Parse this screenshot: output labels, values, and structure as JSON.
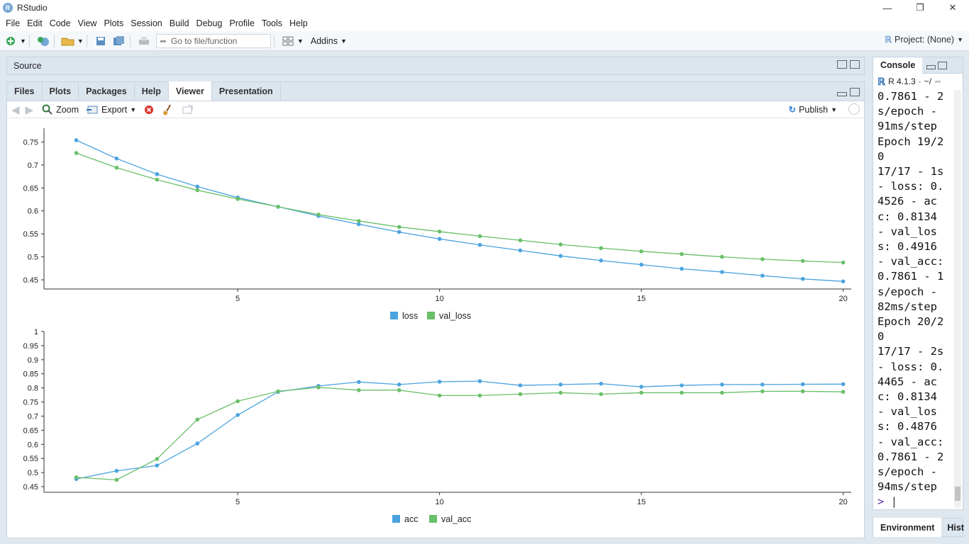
{
  "app": {
    "title": "RStudio",
    "logo_letter": "R"
  },
  "window_controls": {
    "minimize": "—",
    "maximize": "❐",
    "close": "✕"
  },
  "menu": [
    "File",
    "Edit",
    "Code",
    "View",
    "Plots",
    "Session",
    "Build",
    "Debug",
    "Profile",
    "Tools",
    "Help"
  ],
  "toolbar": {
    "goto_placeholder": "Go to file/function",
    "addins": "Addins",
    "project": "Project: (None)"
  },
  "source_pane": {
    "label": "Source"
  },
  "viewer_pane": {
    "tabs": [
      "Files",
      "Plots",
      "Packages",
      "Help",
      "Viewer",
      "Presentation"
    ],
    "active_tab": "Viewer",
    "zoom": "Zoom",
    "export": "Export",
    "publish": "Publish"
  },
  "console": {
    "tab": "Console",
    "version": "R 4.1.3",
    "path": "~/",
    "lines": [
      "0.7861 - 2",
      "s/epoch -",
      "91ms/step",
      "Epoch 19/2",
      "0",
      "17/17 - 1s",
      "- loss: 0.",
      "4526 - ac",
      "c: 0.8134",
      "- val_los",
      "s: 0.4916",
      "- val_acc:",
      "0.7861 - 1",
      "s/epoch -",
      "82ms/step",
      "Epoch 20/2",
      "0",
      "17/17 - 2s",
      "- loss: 0.",
      "4465 - ac",
      "c: 0.8134",
      "- val_los",
      "s: 0.4876",
      "- val_acc:",
      "0.7861 - 2",
      "s/epoch -",
      "94ms/step"
    ],
    "prompt": ">"
  },
  "environment_pane": {
    "tab": "Environment",
    "tab2": "Hist"
  },
  "colors": {
    "loss": "#4aa3df",
    "val_loss": "#6abf69",
    "accent": "#75a7d6"
  },
  "chart_data": [
    {
      "type": "line",
      "x": [
        1,
        2,
        3,
        4,
        5,
        6,
        7,
        8,
        9,
        10,
        11,
        12,
        13,
        14,
        15,
        16,
        17,
        18,
        19,
        20
      ],
      "series": [
        {
          "name": "loss",
          "values": [
            0.754,
            0.714,
            0.68,
            0.653,
            0.629,
            0.609,
            0.589,
            0.571,
            0.554,
            0.539,
            0.526,
            0.514,
            0.502,
            0.492,
            0.483,
            0.474,
            0.467,
            0.459,
            0.452,
            0.4465
          ]
        },
        {
          "name": "val_loss",
          "values": [
            0.726,
            0.694,
            0.668,
            0.645,
            0.626,
            0.609,
            0.592,
            0.578,
            0.565,
            0.555,
            0.545,
            0.536,
            0.527,
            0.519,
            0.512,
            0.506,
            0.5,
            0.495,
            0.491,
            0.4876
          ]
        }
      ],
      "yticks": [
        "0.75",
        "0.7",
        "0.65",
        "0.6",
        "0.55",
        "0.5",
        "0.45"
      ],
      "xticks": [
        "5",
        "10",
        "15",
        "20"
      ],
      "ylim": [
        0.43,
        0.78
      ],
      "xlim": [
        0.2,
        20.2
      ],
      "legend": "bottom"
    },
    {
      "type": "line",
      "x": [
        1,
        2,
        3,
        4,
        5,
        6,
        7,
        8,
        9,
        10,
        11,
        12,
        13,
        14,
        15,
        16,
        17,
        18,
        19,
        20
      ],
      "series": [
        {
          "name": "acc",
          "values": [
            0.477,
            0.506,
            0.525,
            0.603,
            0.704,
            0.786,
            0.807,
            0.821,
            0.812,
            0.822,
            0.824,
            0.809,
            0.812,
            0.815,
            0.804,
            0.809,
            0.812,
            0.812,
            0.813,
            0.8134
          ]
        },
        {
          "name": "val_acc",
          "values": [
            0.483,
            0.474,
            0.548,
            0.688,
            0.753,
            0.788,
            0.802,
            0.792,
            0.792,
            0.773,
            0.773,
            0.778,
            0.783,
            0.778,
            0.783,
            0.783,
            0.783,
            0.788,
            0.788,
            0.7861
          ]
        }
      ],
      "yticks": [
        "1",
        "0.95",
        "0.9",
        "0.85",
        "0.8",
        "0.75",
        "0.7",
        "0.65",
        "0.6",
        "0.55",
        "0.5",
        "0.45"
      ],
      "xticks": [
        "5",
        "10",
        "15",
        "20"
      ],
      "ylim": [
        0.43,
        1.0
      ],
      "xlim": [
        0.2,
        20.2
      ],
      "legend": "bottom"
    }
  ]
}
